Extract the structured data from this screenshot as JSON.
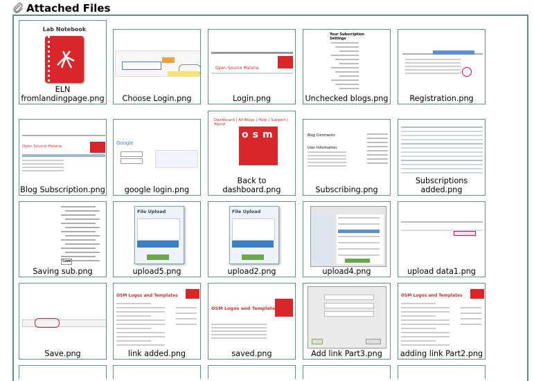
{
  "section": {
    "title": "Attached Files",
    "icon": "paperclip-icon"
  },
  "colors": {
    "border": "#5e8e8e",
    "osm_red": "#d8262b",
    "header_red": "#c9302c"
  },
  "files": [
    {
      "name": "ELN\nfromlandingpage.png",
      "thumb": "notebook",
      "notebook_title": "Lab Notebook"
    },
    {
      "name": "Choose Login.png",
      "thumb": "login-choose"
    },
    {
      "name": "Login.png",
      "thumb": "login-page"
    },
    {
      "name": "Unchecked blogs.png",
      "thumb": "blog-list"
    },
    {
      "name": "Registration.png",
      "thumb": "registration"
    },
    {
      "name": "Blog Subscription.png",
      "thumb": "blog-sub"
    },
    {
      "name": "google login.png",
      "thumb": "google-login"
    },
    {
      "name": "Back to\ndashboard.png",
      "thumb": "dashboard",
      "dash_text": "Dashboard | All Blogs | Help | Support | About"
    },
    {
      "name": "Subscribing.png",
      "thumb": "subscribing"
    },
    {
      "name": "Subscriptions\nadded.png",
      "thumb": "subs-added"
    },
    {
      "name": "Saving sub.png",
      "thumb": "saving-sub"
    },
    {
      "name": "upload5.png",
      "thumb": "file-upload"
    },
    {
      "name": "upload2.png",
      "thumb": "file-upload"
    },
    {
      "name": "upload4.png",
      "thumb": "file-browser"
    },
    {
      "name": "upload data1.png",
      "thumb": "upload-data"
    },
    {
      "name": "Save.png",
      "thumb": "save-bar"
    },
    {
      "name": "link added.png",
      "thumb": "osm-page"
    },
    {
      "name": "saved.png",
      "thumb": "saved"
    },
    {
      "name": "Add link Part3.png",
      "thumb": "link-dialog"
    },
    {
      "name": "adding link Part2.png",
      "thumb": "osm-page"
    }
  ],
  "thumb_text": {
    "osm_title": "OSM Logos and Templates",
    "osm_malaria": "Open Source Malaria",
    "file_upload": "File Upload",
    "blog_heading": "Your Subscription Settings",
    "save_label": "Save"
  }
}
